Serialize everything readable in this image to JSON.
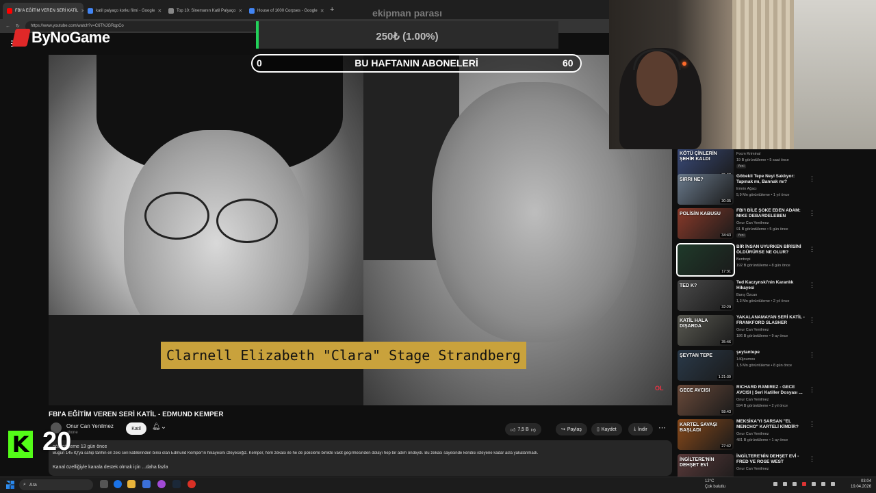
{
  "browser": {
    "tabs": [
      {
        "label": "FBI'A EĞİTİM VEREN SERİ KATİL",
        "color": "#ff0000"
      },
      {
        "label": "katil palyaço korku filmi - Google",
        "color": "#4285f4"
      },
      {
        "label": "Top 10: Sinemanın Katil Palyaço",
        "color": "#888888"
      },
      {
        "label": "House of 1000 Corpses - Google",
        "color": "#4285f4"
      }
    ],
    "url": "https://www.youtube.com/watch?v=C6TNJGRqpCo"
  },
  "overlay": {
    "brand": "ByNoGame",
    "donation_title": "ekipman parası",
    "donation_value": "250₺ (1.00%)",
    "subs_left": "0",
    "subs_label": "BU HAFTANIN ABONELERİ",
    "subs_right": "60",
    "kick_count": "20"
  },
  "video": {
    "caption": "Clarnell Elizabeth \"Clara\" Stage Strandberg",
    "watermark": "OL",
    "title": "FBI'A EĞİTİM VEREN SERİ KATİL - EDMUND KEMPER",
    "channel": "Onur Can Yenilmez",
    "subs": "abone",
    "tag": "Katil",
    "likes": "7,5 B",
    "share": "Paylaş",
    "save": "Kaydet",
    "download": "İndir",
    "desc_meta": "görüntüleme  13 gün önce",
    "desc_text": "Bugün 145 IQ'ya sahip tarihin en zeki seri katillerinden birisi olan Edmund Kemper'ın hikayesini izleyeceğiz. Kemper, hem zekası ile he de polislerle birlikte vakit geçirmesinden dolayı hep bir adım öndeydi. Bu zekası sayesinde kendisi isteyene kadar asla yakalanmadı.",
    "desc_support": "Kanal özelliğiyle kanala destek olmak için  ...daha fazla"
  },
  "sidebar": [
    {
      "title": "",
      "channel": "Focm Kriminal",
      "meta": "19 B görüntüleme • 5 saat önce",
      "badge": "Yeni",
      "duration": "35:02",
      "thumb_text": "KÖTÜ ÇİNLERİN ŞEHİR KALDI",
      "color": "#3a4b7a"
    },
    {
      "title": "Göbekli Tepe Neyi Saklıyor: Tapınak mı, Bannak mı?",
      "channel": "Emrin Ağacı",
      "meta": "5,9 Mn görüntüleme • 1 yıl önce",
      "badge": "",
      "duration": "30:35",
      "thumb_text": "SIRRI NE?",
      "color": "#6a7a8c"
    },
    {
      "title": "FBI'I BİLE ŞOKE EDEN ADAM: MIKE DEBARDELEBEN",
      "channel": "Onur Can Yenilmez",
      "meta": "91 B görüntüleme • 5 gün önce",
      "badge": "Yeni",
      "duration": "34:43",
      "thumb_text": "POLİSİN KABUSU",
      "color": "#8a3a2a"
    },
    {
      "title": "BİR İNSAN UYURKEN BİRİSİNİ ÖLDÜRÜRSE NE OLUR?",
      "channel": "Bentropi",
      "meta": "192 B görüntüleme • 8 gün önce",
      "badge": "",
      "duration": "17:31",
      "thumb_text": "",
      "color": "#1f3a2a"
    },
    {
      "title": "Ted Kaczynski'nin Karanlık Hikayesi",
      "channel": "Barış Özcan",
      "meta": "1,3 Mn görüntüleme • 2 yıl önce",
      "badge": "",
      "duration": "32:29",
      "thumb_text": "TED K?",
      "color": "#4a4a4a"
    },
    {
      "title": "YAKALANAMAYAN SERİ KATİL - FRANKFORD SLASHER",
      "channel": "Onur Can Yenilmez",
      "meta": "186 B görüntüleme • 9 ay önce",
      "badge": "",
      "duration": "35:46",
      "thumb_text": "KATİL HALA DIŞARDA",
      "color": "#5a5a52"
    },
    {
      "title": "şeytantepe",
      "channel": "140journos",
      "meta": "1,5 Mn görüntüleme • 8 gün önce",
      "badge": "",
      "duration": "1:21:30",
      "thumb_text": "ŞEYTAN TEPE",
      "color": "#2a3a4a"
    },
    {
      "title": "RICHARD RAMIREZ - GECE AVCISI | Seri Katiller Dosyası ...",
      "channel": "Onur Can Yenilmez",
      "meta": "594 B görüntüleme • 2 yıl önce",
      "badge": "",
      "duration": "58:43",
      "thumb_text": "GECE AVCISI",
      "color": "#6a4a3a"
    },
    {
      "title": "MEKSİKA'YI SARSAN \"EL MENCHO\" KARTELİ KİMDİR?",
      "channel": "Onur Can Yenilmez",
      "meta": "481 B görüntüleme • 1 ay önce",
      "badge": "",
      "duration": "27:42",
      "thumb_text": "KARTEL SAVAŞI BAŞLADI",
      "color": "#8a4a1a"
    },
    {
      "title": "İNGİLTERE'NİN DEHŞET EVİ - FRED VE ROSE WEST",
      "channel": "Onur Can Yenilmez",
      "meta": "",
      "badge": "",
      "duration": "",
      "thumb_text": "İNGİLTERE'NİN DEHŞET EVİ",
      "color": "#5a3a3a"
    }
  ],
  "taskbar": {
    "search_placeholder": "Ara",
    "weather_temp": "12°C",
    "weather_desc": "Çok bulutlu",
    "time": "03:04",
    "date": "19.04.2026"
  }
}
